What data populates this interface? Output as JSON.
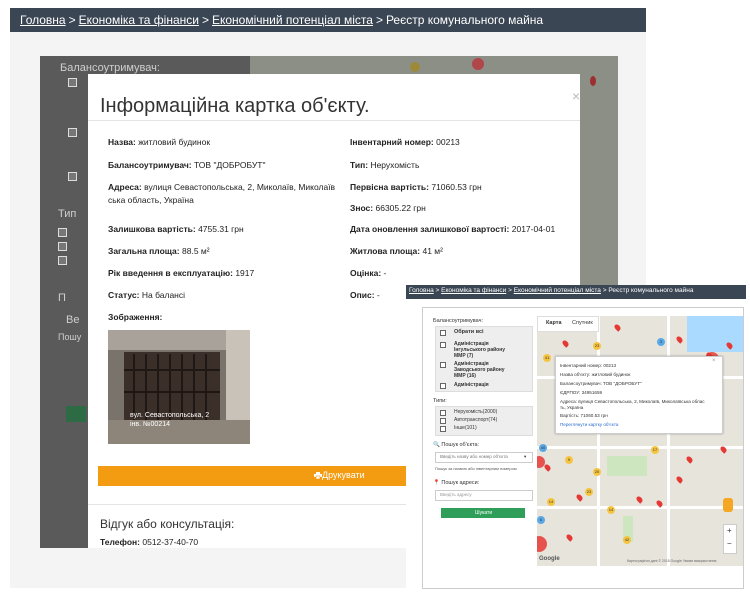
{
  "breadcrumb": {
    "items": [
      "Головна",
      "Економіка та фінанси",
      "Економічний потенціал міста"
    ],
    "current": "Реєстр комунального майна",
    "separator": ">"
  },
  "background_page": {
    "balance_label": "Балансоутримувач:",
    "types_label": "Тип",
    "search_label": "П",
    "search_value": "Ве",
    "search_hint": "Пошу"
  },
  "modal": {
    "title": "Інформаційна картка об'єкту.",
    "close": "×",
    "left_fields": [
      {
        "label": "Назва:",
        "value": "житловий будинок"
      },
      {
        "label": "Балансоутримувач:",
        "value": "ТОВ \"ДОБРОБУТ\""
      },
      {
        "label": "Адреса:",
        "value": "вулиця Севастопольська, 2, Миколаїв, Миколаїв"
      },
      {
        "label": "",
        "value": "ська область, Україна"
      },
      {
        "label": "Залишкова вартість:",
        "value": "4755.31 грн"
      },
      {
        "label": "Загальна площа:",
        "value": "88.5 м²"
      },
      {
        "label": "Рік введення в експлуатацію:",
        "value": "1917"
      },
      {
        "label": "Статус:",
        "value": "На балансі"
      },
      {
        "label": "Зображення:",
        "value": ""
      }
    ],
    "right_fields": [
      {
        "label": "Інвентарний номер:",
        "value": "00213"
      },
      {
        "label": "Тип:",
        "value": "Нерухомість"
      },
      {
        "label": "Первісна вартість:",
        "value": "71060.53 грн"
      },
      {
        "label": "Знос:",
        "value": "66305.22 грн"
      },
      {
        "label": "Дата оновлення залишкової вартості:",
        "value": "2017-04-01"
      },
      {
        "label": "Житлова площа:",
        "value": "41 м²"
      },
      {
        "label": "Оцінка:",
        "value": "-"
      },
      {
        "label": "Опис:",
        "value": "-"
      }
    ],
    "photo_caption_line1": "вул. Севастопольська, 2",
    "photo_caption_line2": "інв. №00214",
    "print_icon": "print-icon",
    "print_label": "Друкувати",
    "feedback_title": "Відгук або консультація:",
    "phone_label": "Телефон:",
    "phone_value": "0512-37-40-70"
  },
  "inset": {
    "breadcrumb": {
      "items": [
        "Головна",
        "Економіка та фінанси",
        "Економічний потенціал міста"
      ],
      "current": "Реєстр комунального майна"
    },
    "balance_label": "Балансоутримувач:",
    "balance_items": [
      "Обрати всі",
      "Адміністрація",
      "Інгульського району",
      "ММР (7)",
      "Адміністрація",
      "Заводського району",
      "ММР (16)",
      "Адміністрація"
    ],
    "types_label": "Типи:",
    "types_items": [
      "Нерухомість(2000)",
      "Автотранспорт(74)",
      "Інше(101)"
    ],
    "object_search_label": "Пошук об'єкта:",
    "object_search_placeholder": "Введіть назву або номер об'єкта",
    "object_search_hint": "Пошук за назвою або інвентарним номером",
    "address_search_label": "Пошук адреси:",
    "address_placeholder": "Введіть адресу",
    "search_button": "Шукати",
    "map_tabs": [
      "Карта",
      "Спутник"
    ],
    "popup": {
      "close": "×",
      "lines": [
        "Інвентарний номер: 00213",
        "Назва об'єкту: житловий будинок",
        "Балансоутримувач: ТОВ \"ДОБРОБУТ\"",
        "ЄДРПОУ: 34951659",
        "Адреса: вулиця Севастопольська, 2, Миколаїв, Миколаївська облас",
        "ть, Україна",
        "Вартість: 71060.53 грн"
      ],
      "link": "Переглянути картку об'єкта"
    },
    "zoom_in": "+",
    "zoom_out": "−",
    "google": "Google",
    "map_footer": "Картографічні дані © 2018 Google   Умови використання",
    "clusters": [
      "41",
      "23",
      "3",
      "40",
      "17",
      "9",
      "20",
      "23",
      "14",
      "14",
      "42",
      "6"
    ]
  },
  "colors": {
    "crumb_bar": "#3b4654",
    "print_button": "#f39c12",
    "search_button": "#2e9e59",
    "pin": "#e53935"
  }
}
